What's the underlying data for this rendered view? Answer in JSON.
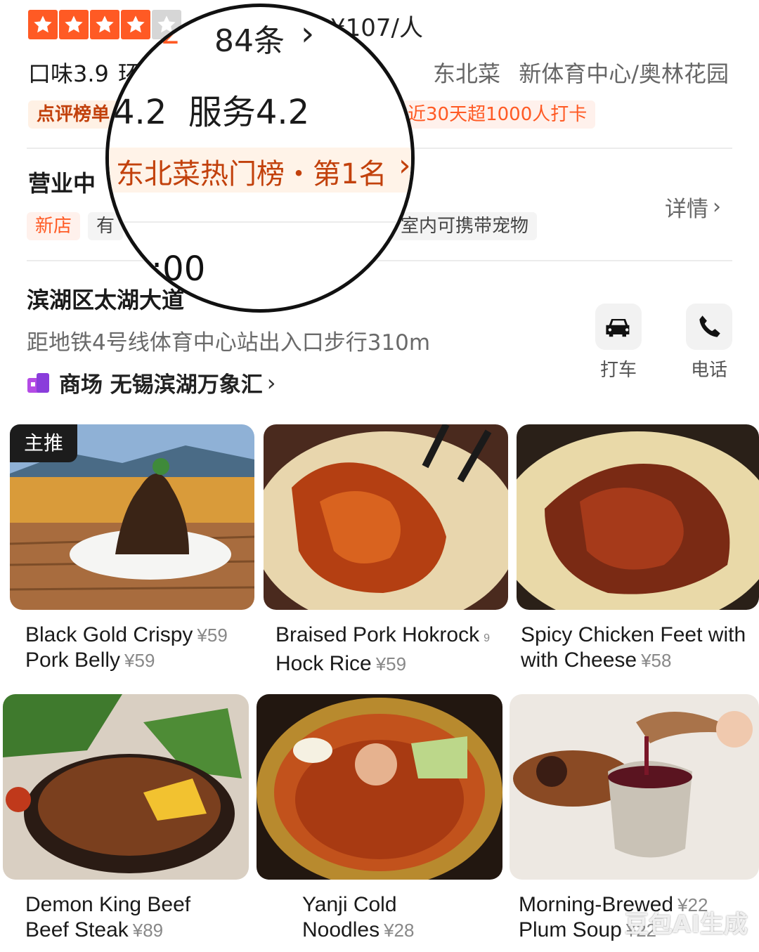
{
  "header": {
    "rating_value_partial": ".2",
    "review_count": "84条",
    "price_per_person": "¥107/人",
    "stars": {
      "filled": 4,
      "total": 5
    },
    "taste_score": "口味3.9",
    "env_partial": "环",
    "cuisine": "东北菜",
    "area": "新体育中心/奥林花园",
    "list_tag": "点评榜单",
    "checkin_tag": "近30天超1000人打卡",
    "accent_color": "#ff5a24"
  },
  "magnifier": {
    "top_rating": ".2",
    "top_count": "84条",
    "scores": "4.2  服务4.2",
    "ranking": "东北菜热门榜・第1名",
    "time": ":00"
  },
  "status": {
    "open_label": "营业中",
    "details_label": "详情",
    "tags": [
      "新店",
      "有",
      "室内可携带宠物"
    ]
  },
  "location": {
    "address": "滨湖区太湖大道",
    "metro": "距地铁4号线体育中心站出入口步行310m",
    "mall": "商场 无锡滨湖万象汇",
    "actions": [
      {
        "label": "打车",
        "icon": "car-icon"
      },
      {
        "label": "电话",
        "icon": "phone-icon"
      }
    ]
  },
  "dishes": [
    {
      "badge": "主推",
      "line1": "Black Gold Crispy",
      "price1": "¥59",
      "line2": "Pork Belly",
      "price2": "¥59"
    },
    {
      "line1": "Braised Pork Hokrock",
      "price1": "9",
      "line2": "Hock Rice",
      "price2": "¥59"
    },
    {
      "line1": "Spicy Chicken Feet with",
      "price1": "",
      "line2": "with Cheese",
      "price2": "¥58"
    },
    {
      "line1": "Demon King Beef",
      "price1": "",
      "line2": "Beef Steak",
      "price2": "¥89"
    },
    {
      "line1": "Yanji Cold",
      "price1": "",
      "line2": "Noodles",
      "price2": "¥28"
    },
    {
      "line1": "Morning-Brewed",
      "price1": "¥22",
      "line2": "Plum Soup",
      "price2": "¥22"
    }
  ],
  "watermark": "豆包AI生成"
}
